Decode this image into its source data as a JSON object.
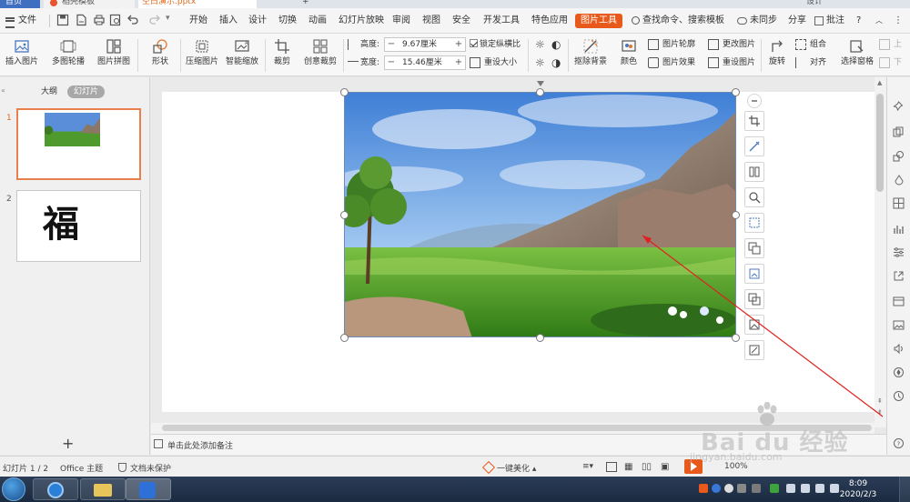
{
  "tabs": {
    "home": "首页",
    "template": "稻壳模板",
    "document": "空白演示.pptx",
    "new_tab": "+",
    "user": "设计"
  },
  "menu": {
    "file": "文件",
    "items": [
      "开始",
      "插入",
      "设计",
      "切换",
      "动画",
      "幻灯片放映",
      "审阅",
      "视图",
      "安全",
      "开发工具",
      "特色应用",
      "图片工具"
    ],
    "search": "查找命令、搜索模板",
    "sync": "未同步",
    "share": "分享",
    "annotate": "批注",
    "help": "?"
  },
  "ribbon": {
    "insert_picture": "插入图片",
    "multi_outline": "多图轮播",
    "picture_collage": "图片拼图",
    "shape": "形状",
    "compress": "压缩图片",
    "smart_zoom": "智能缩放",
    "crop": "裁剪",
    "creative_crop": "创意裁剪",
    "height_label": "高度:",
    "height_value": "9.67厘米",
    "width_label": "宽度:",
    "width_value": "15.46厘米",
    "lock_ratio": "锁定纵横比",
    "reset_size": "重设大小",
    "remove_bg": "抠除背景",
    "color": "颜色",
    "picture_outline": "图片轮廓",
    "picture_effect": "图片效果",
    "change_picture": "更改图片",
    "reset_picture": "重设图片",
    "rotate": "旋转",
    "group": "组合",
    "align": "对齐",
    "selection_pane": "选择窗格",
    "up": "上",
    "down": "下"
  },
  "left_panel": {
    "outline_tab": "大纲",
    "slides_tab": "幻灯片",
    "slide1_num": "1",
    "slide2_num": "2",
    "slide2_text": "福",
    "add": "+"
  },
  "notes": {
    "placeholder": "单击此处添加备注"
  },
  "status": {
    "slide_count": "幻灯片 1 / 2",
    "theme": "Office 主题",
    "protect": "文档未保护",
    "beautify": "一键美化",
    "zoom": "100%"
  },
  "taskbar": {
    "time": "8:09",
    "date": "2020/2/3"
  },
  "watermark": {
    "brand": "Bai du 经验",
    "url": "jingyan.baidu.com"
  },
  "colors": {
    "accent": "#e85a1b",
    "selection_border": "#e8804d",
    "arrow": "#e02020"
  }
}
